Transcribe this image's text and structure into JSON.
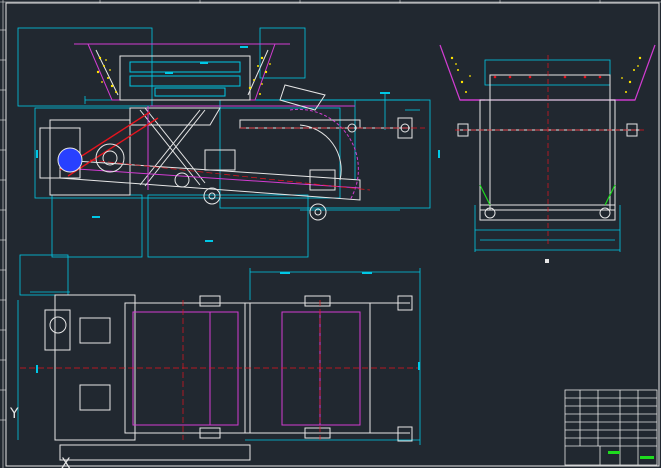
{
  "colors": {
    "background": "#212830",
    "outline": "#e6e6e6",
    "dimension": "#00c8e6",
    "centerline": "#e6141e",
    "hidden": "#d23cd2",
    "material": "#ffe600",
    "green": "#1edc1e",
    "blue": "#2840ff"
  },
  "drawing": {
    "ucs_y_label": "Y",
    "ucs_x_label": "X"
  }
}
